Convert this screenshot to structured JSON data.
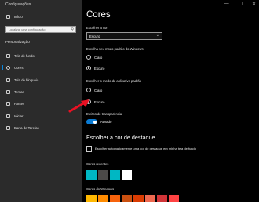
{
  "window": {
    "title": "Configurações",
    "controls": [
      "—",
      "☐",
      "✕"
    ]
  },
  "sidebar": {
    "home_label": "Início",
    "search_placeholder": "Localizar uma configuração",
    "section_label": "Personalização",
    "items": [
      {
        "label": "Tela de fundo",
        "icon": "image-icon"
      },
      {
        "label": "Cores",
        "icon": "palette-icon",
        "active": true
      },
      {
        "label": "Tela de bloqueio",
        "icon": "monitor-lock-icon"
      },
      {
        "label": "Temas",
        "icon": "brush-icon"
      },
      {
        "label": "Fontes",
        "icon": "font-icon"
      },
      {
        "label": "Iniciar",
        "icon": "start-icon"
      },
      {
        "label": "Barra de Tarefas",
        "icon": "taskbar-icon"
      }
    ]
  },
  "main": {
    "title": "Cores",
    "choose_color_label": "Escolher a cor",
    "choose_color_value": "Escuro",
    "windows_mode_label": "Escolha seu modo padrão do Windows",
    "windows_mode_options": [
      "Claro",
      "Escuro"
    ],
    "windows_mode_selected": "Escuro",
    "app_mode_label": "Escolher o modo de aplicativo padrão",
    "app_mode_options": [
      "Claro",
      "Escuro"
    ],
    "app_mode_selected": "Escuro",
    "transparency_label": "Efeitos de transparência",
    "transparency_state": "Ativado",
    "accent_title": "Escolher a cor de destaque",
    "auto_accent_text": "Escolher automaticamente uma cor de destaque em minha tela de fundo",
    "recent_colors_label": "Cores recentes",
    "recent_colors": [
      "#00b7c3",
      "#4c4a48",
      "#00b7c3",
      "#ffffff"
    ],
    "windows_colors_label": "Cores do Windows",
    "windows_colors": [
      "#ffb900",
      "#ff8c00",
      "#f7630c",
      "#ca5010",
      "#da3b01",
      "#ef6950",
      "#d13438",
      "#ff4343"
    ]
  },
  "annotation_arrow_color": "#e81123"
}
